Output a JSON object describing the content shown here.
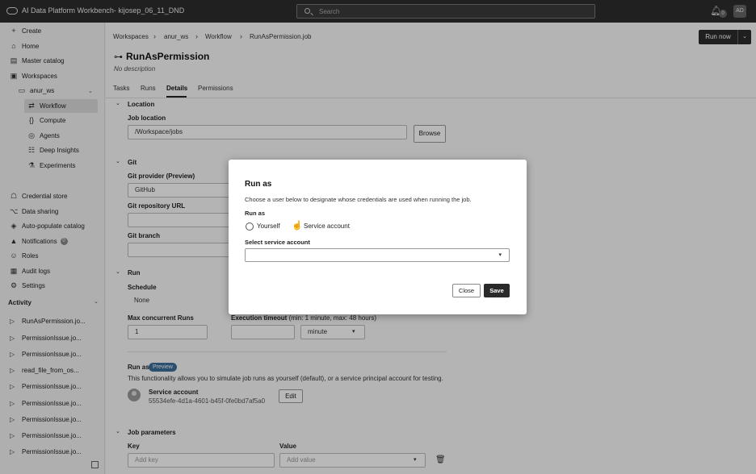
{
  "topbar": {
    "app_title": "AI Data Platform Workbench- kijosep_06_11_DND",
    "search_placeholder": "Search",
    "notification_count": "0",
    "user_initials": "AD"
  },
  "sidebar": {
    "create": "Create",
    "home": "Home",
    "master_catalog": "Master catalog",
    "workspaces": "Workspaces",
    "workspace_name": "anur_ws",
    "workflow": "Workflow",
    "compute": "Compute",
    "agents": "Agents",
    "deep_insights": "Deep Insights",
    "experiments": "Experiments",
    "credential_store": "Credential store",
    "data_sharing": "Data sharing",
    "auto_populate_catalog": "Auto-populate catalog",
    "notifications": "Notifications",
    "notifications_count": "0",
    "roles": "Roles",
    "audit_logs": "Audit logs",
    "settings": "Settings",
    "activity_heading": "Activity",
    "activity_items": [
      "RunAsPermission.jo...",
      "PermissionIssue.jo...",
      "PermissionIssue.jo...",
      "read_file_from_os...",
      "PermissionIssue.jo...",
      "PermissionIssue.jo...",
      "PermissionIssue.jo...",
      "PermissionIssue.jo...",
      "PermissionIssue.jo..."
    ]
  },
  "breadcrumb": {
    "workspaces": "Workspaces",
    "workspace": "anur_ws",
    "workflow": "Workflow",
    "job": "RunAsPermission.job"
  },
  "header": {
    "run_now": "Run now",
    "title": "RunAsPermission",
    "description": "No description"
  },
  "tabs": [
    "Tasks",
    "Runs",
    "Details",
    "Permissions"
  ],
  "location": {
    "section": "Location",
    "job_location_label": "Job location",
    "job_location_value": "/Workspace/jobs",
    "browse": "Browse"
  },
  "git": {
    "section": "Git",
    "provider_label": "Git provider (Preview)",
    "provider_value": "GitHub",
    "repo_label": "Git repository URL",
    "branch_label": "Git branch"
  },
  "run": {
    "section": "Run",
    "schedule_label": "Schedule",
    "schedule_value": "None",
    "max_concurrent_label": "Max concurrent Runs",
    "max_concurrent_value": "1",
    "timeout_label": "Execution timeout",
    "timeout_hint": "(min: 1 minute, max: 48 hours)",
    "timeout_unit": "minute",
    "run_as_label": "Run as",
    "preview_badge": "Preview",
    "run_as_desc": "This functionality allows you to simulate job runs as yourself (default), or a service principal account for testing.",
    "service_account_label": "Service account",
    "service_account_id": "55534efe-4d1a-4601-b45f-0fe0bd7af5a0",
    "edit": "Edit"
  },
  "job_parameters": {
    "section": "Job parameters",
    "key_label": "Key",
    "value_label": "Value",
    "key_placeholder": "Add key",
    "value_placeholder": "Add value"
  },
  "modal": {
    "title": "Run as",
    "description": "Choose a user below to designate whose credentials are used when running the job.",
    "run_as_label": "Run as",
    "option_yourself": "Yourself",
    "option_service": "Service account",
    "select_label": "Select service account",
    "close": "Close",
    "save": "Save"
  }
}
